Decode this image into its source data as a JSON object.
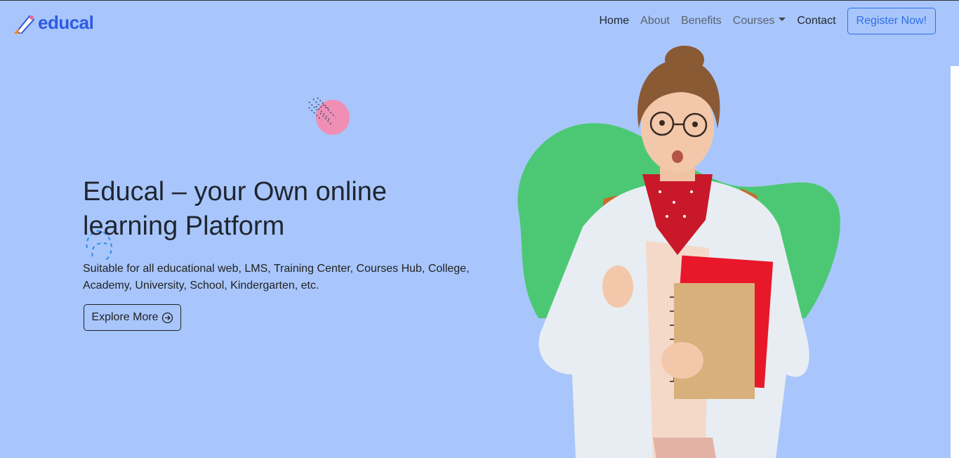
{
  "brand": {
    "name": "educal",
    "icon": "pencil-icon"
  },
  "nav": {
    "items": [
      {
        "label": "Home",
        "active": true
      },
      {
        "label": "About",
        "active": false
      },
      {
        "label": "Benefits",
        "active": false
      },
      {
        "label": "Courses",
        "active": false,
        "dropdown": true
      },
      {
        "label": "Contact",
        "active": true
      }
    ],
    "register_label": "Register Now!"
  },
  "hero": {
    "title_line1": "Educal – your Own online",
    "title_line2": "learning Platform",
    "subtitle": "Suitable for all educational web, LMS, Training Center, Courses Hub, College, Academy, University, School, Kindergarten, etc.",
    "cta_label": "Explore More",
    "cta_icon": "arrow-right-circle-icon"
  },
  "colors": {
    "background": "#a8c6fb",
    "brand": "#2d5be3",
    "accent_blob": "#4cc874",
    "pink_deco": "#ef8fb6"
  }
}
